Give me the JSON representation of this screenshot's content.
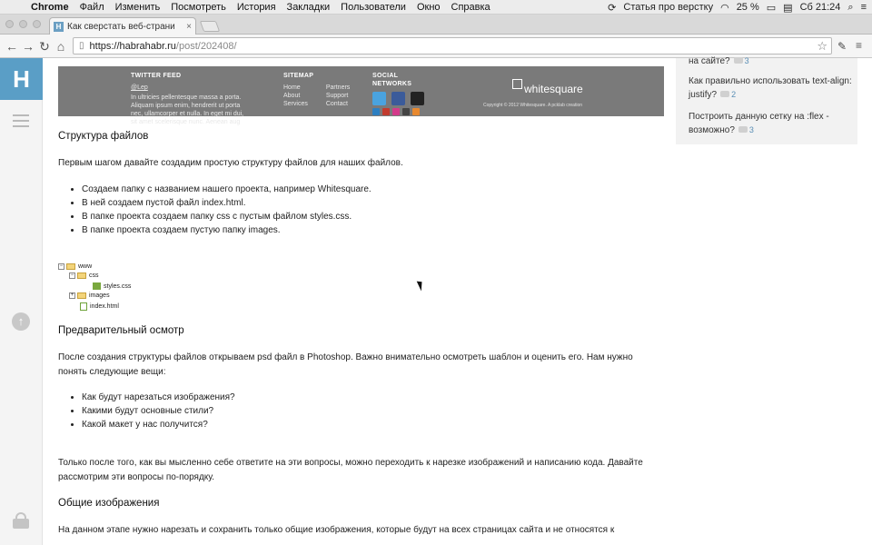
{
  "menubar": {
    "app": "Chrome",
    "items": [
      "Файл",
      "Изменить",
      "Посмотреть",
      "История",
      "Закладки",
      "Пользователи",
      "Окно",
      "Справка"
    ],
    "status_text": "Статья про верстку",
    "battery": "25 %",
    "clock": "Сб 21:24"
  },
  "tab": {
    "title": "Как сверстать веб-страни",
    "favicon": "H",
    "close": "×"
  },
  "omnibox": {
    "host": "https://habrahabr.ru",
    "path": "/post/202408/"
  },
  "sidebar": {
    "logo": "H"
  },
  "banner": {
    "twitter_title": "TWITTER FEED",
    "twitter_user": "@Lep",
    "twitter_text": "In ultricies pellentesque massa a porta. Aliquam ipsum enim, hendrerit ut porta nec, ullamcorper et nulla. In eget mi dui, sit amet scelerisque nunc. Aenean aug",
    "sitemap_title": "SITEMAP",
    "sitemap_col1": [
      "Home",
      "About",
      "Services"
    ],
    "sitemap_col2": [
      "Partners",
      "Support",
      "Contact"
    ],
    "social_title": "SOCIAL NETWORKS",
    "brand": "whitesquare",
    "copyright": "Copyright © 2012 Whitesquare. A pcklab creation"
  },
  "content": {
    "h_structure": "Структура файлов",
    "p_structure": "Первым шагом давайте создадим простую структуру файлов для наших файлов.",
    "list1": [
      "Создаем папку с названием нашего проекта, например Whitesquare.",
      "В ней создаем пустой файл index.html.",
      "В папке проекта создаем папку css с пустым файлом styles.css.",
      "В папке проекта создаем пустую папку images."
    ],
    "tree": {
      "root": "www",
      "css": "css",
      "styles": "styles.css",
      "images": "images",
      "index": "index.html"
    },
    "h_preview": "Предварительный осмотр",
    "p_preview": "После создания структуры файлов открываем psd файл в Photoshop. Важно внимательно осмотреть шаблон и оценить его. Нам нужно понять следующие вещи:",
    "list2": [
      "Как будут нарезаться изображения?",
      "Какими будут основные стили?",
      "Какой макет у нас получится?"
    ],
    "p_after": "Только после того, как вы мысленно себе ответите на эти вопросы, можно переходить к нарезке изображений и написанию кода. Давайте рассмотрим эти вопросы по-порядку.",
    "h_images": "Общие изображения",
    "p_images": "На данном этапе нужно нарезать и сохранить только общие изображения, которые будут на всех страницах сайта и не относятся к"
  },
  "right": {
    "item0_text": "на сайте?",
    "item0_count": "3",
    "item1_text": "Как правильно использовать text-align: justify?",
    "item1_count": "2",
    "item2_text": "Построить данную сетку на :flex - возможно?",
    "item2_count": "3"
  },
  "colors": {
    "accent": "#5a9ec6",
    "banner": "#7a7a7a"
  }
}
